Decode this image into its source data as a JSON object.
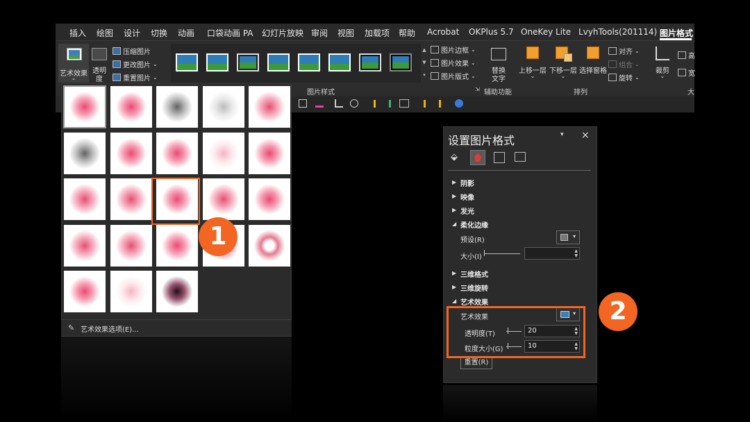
{
  "ribbon": {
    "tabs": [
      "插入",
      "绘图",
      "设计",
      "切换",
      "动画",
      "口袋动画 PA",
      "幻灯片放映",
      "审阅",
      "视图",
      "加载项",
      "帮助",
      "Acrobat",
      "OKPlus 5.7",
      "OneKey Lite",
      "LvyhTools(201114)",
      "图片格式"
    ],
    "active_tab": "图片格式",
    "artistic_effects_label": "艺术效果",
    "transparency_label_1": "透明",
    "transparency_label_2": "度",
    "compress_label": "压缩图片",
    "change_label": "更改图片",
    "reset_picture_label": "重置图片",
    "picture_border_label": "图片边框",
    "picture_effects_label": "图片效果",
    "picture_layout_label": "图片版式",
    "picture_styles_group": "图片样式",
    "alt_text_label_1": "替换",
    "alt_text_label_2": "文字",
    "accessibility_group": "辅助功能",
    "bring_forward_label": "上移一层",
    "send_backward_label": "下移一层",
    "selection_pane_label": "选择窗格",
    "align_label": "对齐",
    "group_label": "组合",
    "rotate_label": "旋转",
    "arrange_group": "排列",
    "crop_label": "裁剪",
    "height_label": "高",
    "width_label": "宽",
    "size_group_partial": "大"
  },
  "gallery": {
    "footer_label": "艺术效果选项(E)...",
    "rows": [
      [
        "pink",
        "pink",
        "grey",
        "lightgrey",
        "pinkdot"
      ],
      [
        "grey",
        "pink",
        "pink",
        "lightpink",
        "pink"
      ],
      [
        "pinkdot",
        "pinkdot",
        "pink",
        "pinkdot",
        "pink"
      ],
      [
        "pinkdot",
        "pinkdot",
        "pink",
        "pink",
        "ring"
      ],
      [
        "pink",
        "lightpink",
        "dark"
      ]
    ]
  },
  "callouts": {
    "one": "1",
    "two": "2"
  },
  "pane": {
    "title": "设置图片格式",
    "close": "×",
    "sections": {
      "shadow": "阴影",
      "reflection": "映像",
      "glow": "发光",
      "soft_edges": "柔化边缘",
      "three_d_format": "三维格式",
      "three_d_rotation": "三维旋转",
      "artistic_effects": "艺术效果"
    },
    "preset_label": "预设(R)",
    "size_label": "大小(I)",
    "art_effect_label": "艺术效果",
    "transparency_label": "透明度(T)",
    "transparency_value": "20",
    "grain_label": "粒度大小(G)",
    "grain_value": "10",
    "reset_button": "重置(R)"
  },
  "colors": {
    "accent": "#f26522",
    "ribbon_bg": "#2a2a2a",
    "pane_bg": "#2b2b2b"
  }
}
